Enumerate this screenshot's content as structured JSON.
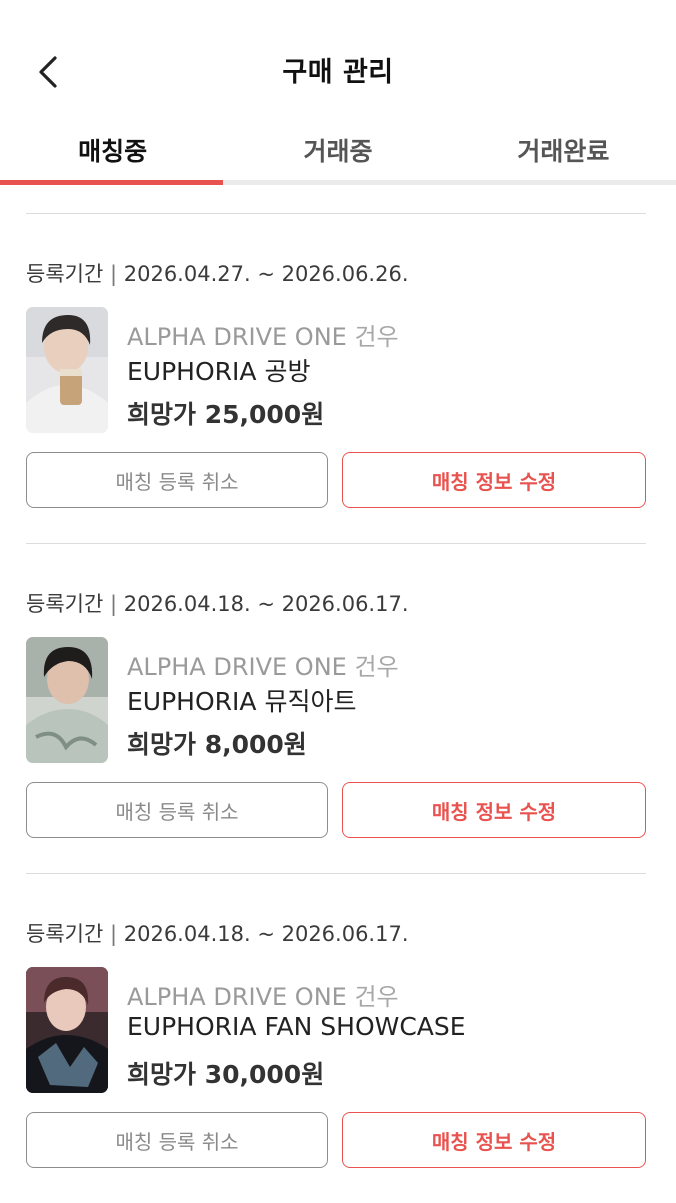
{
  "header": {
    "title": "구매 관리",
    "back_icon": "chevron-left-icon"
  },
  "tabs": [
    {
      "label": "매칭중",
      "active": true
    },
    {
      "label": "거래중",
      "active": false
    },
    {
      "label": "거래완료",
      "active": false
    }
  ],
  "colors": {
    "accent": "#e9534f",
    "muted_text": "#9a9a9a"
  },
  "items": [
    {
      "period_label": "등록기간",
      "period": "2026.04.27. ~ 2026.06.26.",
      "artist": "ALPHA DRIVE ONE",
      "member": "건우",
      "album": "EUPHORIA 공방",
      "price_label": "희망가",
      "price": "25,000원",
      "cancel_label": "매칭 등록 취소",
      "edit_label": "매칭 정보 수정"
    },
    {
      "period_label": "등록기간",
      "period": "2026.04.18. ~ 2026.06.17.",
      "artist": "ALPHA DRIVE ONE",
      "member": "건우",
      "album": "EUPHORIA 뮤직아트",
      "price_label": "희망가",
      "price": "8,000원",
      "cancel_label": "매칭 등록 취소",
      "edit_label": "매칭 정보 수정"
    },
    {
      "period_label": "등록기간",
      "period": "2026.04.18. ~ 2026.06.17.",
      "artist": "ALPHA DRIVE ONE",
      "member": "건우",
      "album": "EUPHORIA FAN SHOWCASE",
      "price_label": "희망가",
      "price": "30,000원",
      "cancel_label": "매칭 등록 취소",
      "edit_label": "매칭 정보 수정"
    }
  ]
}
